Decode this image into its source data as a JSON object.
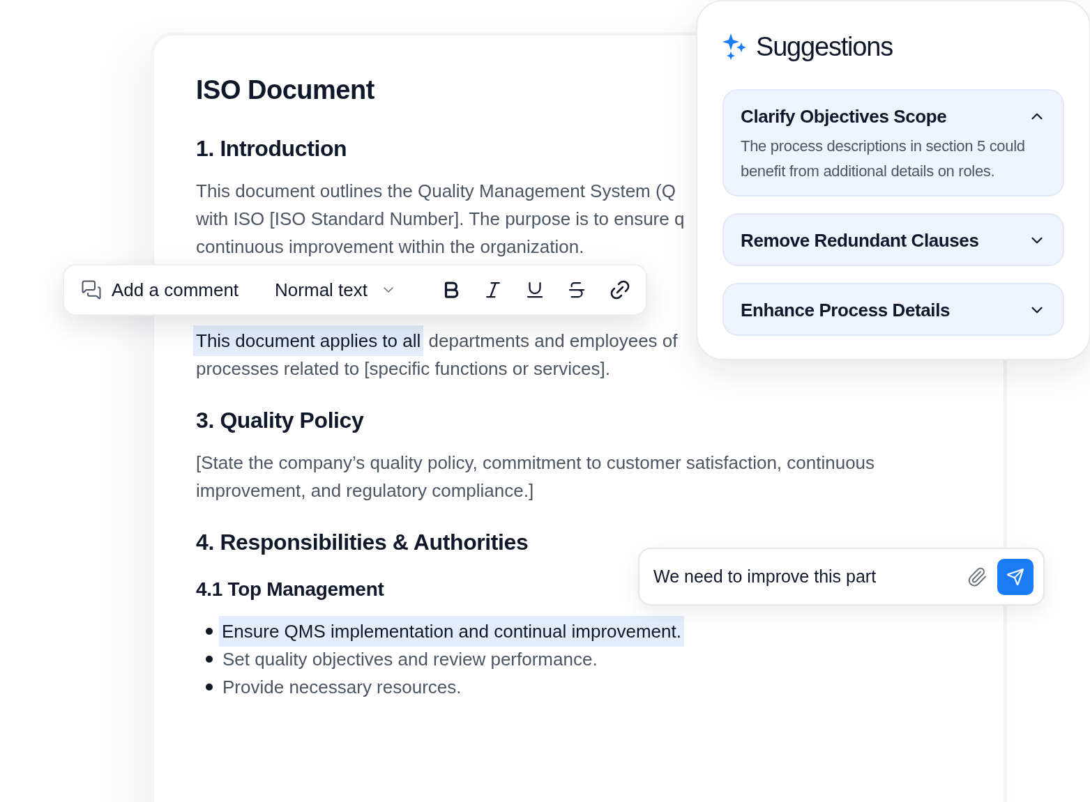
{
  "document": {
    "blocks": [
      {
        "kind": "title",
        "text": "ISO Document"
      },
      {
        "kind": "heading",
        "text": "1. Introduction"
      },
      {
        "kind": "paragraph",
        "lines": [
          [
            {
              "text": "This document outlines the Quality Management System (Q",
              "highlighted": false
            }
          ],
          [
            {
              "text": "with ISO [ISO Standard Number]. The purpose is to ensure q",
              "highlighted": false
            }
          ],
          [
            {
              "text": "continuous improvement within the organization.",
              "highlighted": false
            }
          ]
        ]
      },
      {
        "kind": "paragraph",
        "lines": [
          [
            {
              "text": "This document applies to all",
              "highlighted": true
            },
            {
              "text": " departments and employees of",
              "highlighted": false
            }
          ],
          [
            {
              "text": "processes related to [specific functions or services].",
              "highlighted": false
            }
          ]
        ]
      },
      {
        "kind": "heading",
        "text": "3. Quality Policy"
      },
      {
        "kind": "paragraph",
        "lines": [
          [
            {
              "text": "[State the company’s quality policy, commitment to customer satisfaction, continuous",
              "highlighted": false
            }
          ],
          [
            {
              "text": "improvement, and regulatory compliance.]",
              "highlighted": false
            }
          ]
        ]
      },
      {
        "kind": "heading",
        "text": "4. Responsibilities & Authorities"
      },
      {
        "kind": "subheading",
        "text": "4.1 Top Management"
      },
      {
        "kind": "bullets",
        "items": [
          {
            "text": "Ensure QMS implementation and continual improvement.",
            "highlighted": true
          },
          {
            "text": "Set quality objectives and review performance.",
            "highlighted": false
          },
          {
            "text": "Provide necessary resources.",
            "highlighted": false
          }
        ]
      }
    ]
  },
  "toolbar": {
    "comment_button": "Add a comment",
    "style_dropdown": "Normal text"
  },
  "suggestions": {
    "title": "Suggestions",
    "items": [
      {
        "title": "Clarify Objectives Scope",
        "expanded": true,
        "body": "The process descriptions in section 5 could benefit from additional details on roles."
      },
      {
        "title": "Remove Redundant Clauses",
        "expanded": false
      },
      {
        "title": "Enhance Process Details",
        "expanded": false
      }
    ]
  },
  "comment_input": {
    "value": "We need to improve this part"
  }
}
